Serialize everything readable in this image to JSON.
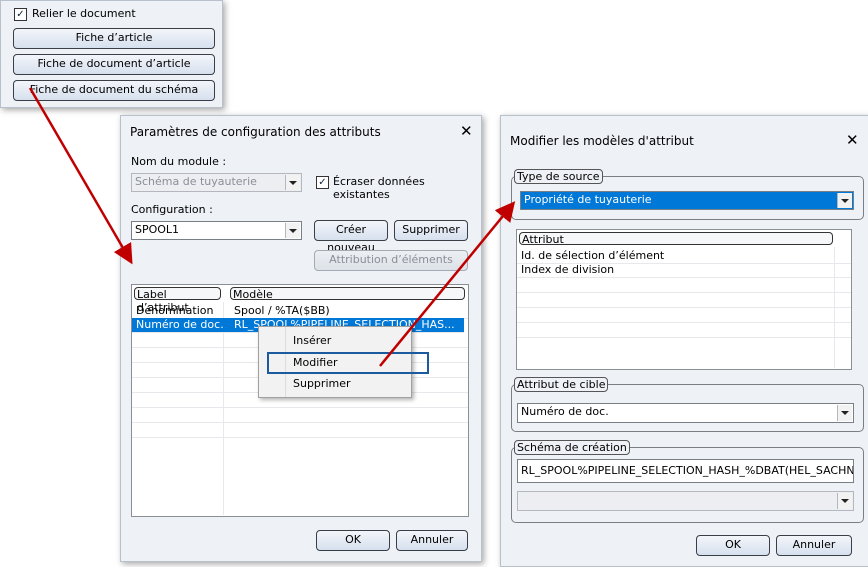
{
  "top_panel": {
    "link_doc_label": "Relier le document",
    "link_doc_checked": true,
    "buttons": [
      "Fiche d’article",
      "Fiche de document d’article",
      "Fiche de document du schéma"
    ]
  },
  "dialog1": {
    "title": "Paramètres de configuration des attributs",
    "module_label": "Nom du module :",
    "module_value": "Schéma de tuyauterie",
    "overwrite_label": "Écraser données existantes",
    "overwrite_checked": true,
    "config_label": "Configuration :",
    "config_value": "SPOOL1",
    "create_new": "Créer nouveau",
    "delete": "Supprimer",
    "assign_elements": "Attribution d’éléments",
    "columns": [
      "Label d’attribut",
      "Modèle"
    ],
    "rows": [
      {
        "label": "Dénomination",
        "model": "Spool / %TA($BB)"
      },
      {
        "label": "Numéro de doc.",
        "model": "RL_SPOOL%PIPELINE_SELECTION_HAS..."
      }
    ],
    "context_menu": [
      "Insérer",
      "Modifier",
      "Supprimer"
    ],
    "ok": "OK",
    "cancel": "Annuler"
  },
  "dialog2": {
    "title": "Modifier les modèles d'attribut",
    "source_type_legend": "Type de source",
    "source_type_value": "Propriété de tuyauterie",
    "attr_column": "Attribut",
    "attributes": [
      "Id. de sélection d’élément",
      "Index de division"
    ],
    "target_legend": "Attribut de cible",
    "target_value": "Numéro de doc.",
    "scheme_legend": "Schéma de création",
    "scheme_value": "RL_SPOOL%PIPELINE_SELECTION_HASH_%DBAT(HEL_SACHNU",
    "ok": "OK",
    "cancel": "Annuler"
  },
  "colors": {
    "selection": "#0078d7",
    "arrow": "#c00000"
  }
}
